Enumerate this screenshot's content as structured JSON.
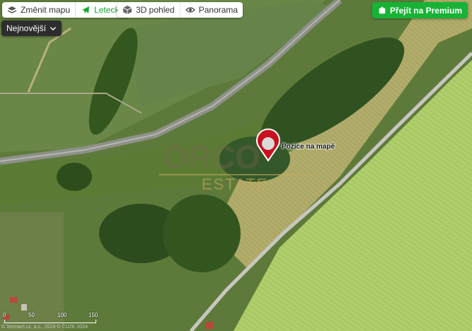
{
  "map_type_switch": {
    "change_map_label": "Změnit mapu",
    "aerial_label": "Letecká"
  },
  "view_switch": {
    "pohled_3d_label": "3D pohled",
    "panorama_label": "Panorama"
  },
  "sort_dropdown": {
    "label": "Nejnovější"
  },
  "premium_button": {
    "label": "Přejít na Premium"
  },
  "marker": {
    "label": "Pozice na mapě",
    "color": "#c8101e"
  },
  "watermark": {
    "brand": "ORCO",
    "sub": "ESTATE"
  },
  "scale_bar": {
    "ticks": [
      "0",
      "50",
      "100",
      "150"
    ]
  },
  "copyright": {
    "text": "© Seznam.cz, a.s., 2024 © ČÚZK 2024"
  },
  "colors": {
    "accent": "#17a832",
    "premium": "#17b336",
    "field": "#9fbf5c",
    "forest": "#2f5220"
  }
}
